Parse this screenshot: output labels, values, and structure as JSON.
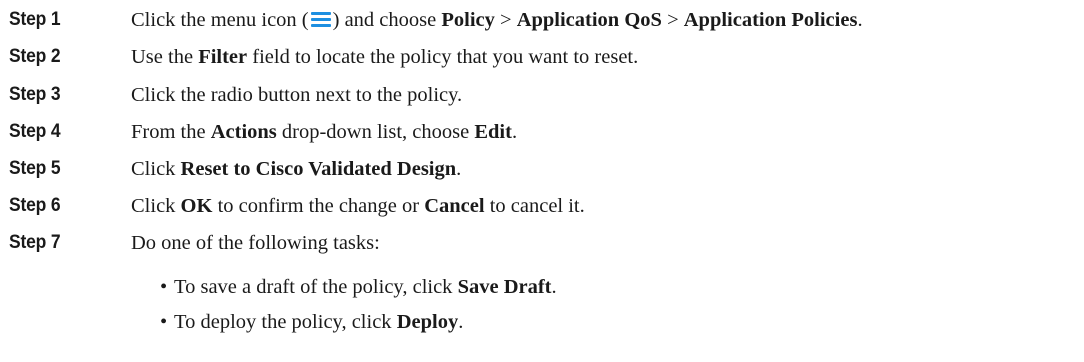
{
  "steps": [
    {
      "label": "Step 1",
      "parts": {
        "t1": "Click the menu icon (",
        "t2": ") and choose ",
        "b1": "Policy",
        "t3": " > ",
        "b2": "Application QoS",
        "t4": " > ",
        "b3": "Application Policies",
        "t5": "."
      }
    },
    {
      "label": "Step 2",
      "parts": {
        "t1": "Use the ",
        "b1": "Filter",
        "t2": " field to locate the policy that you want to reset."
      }
    },
    {
      "label": "Step 3",
      "parts": {
        "t1": "Click the radio button next to the policy."
      }
    },
    {
      "label": "Step 4",
      "parts": {
        "t1": "From the ",
        "b1": "Actions",
        "t2": " drop-down list, choose ",
        "b2": "Edit",
        "t3": "."
      }
    },
    {
      "label": "Step 5",
      "parts": {
        "t1": "Click ",
        "b1": "Reset to Cisco Validated Design",
        "t2": "."
      }
    },
    {
      "label": "Step 6",
      "parts": {
        "t1": "Click ",
        "b1": "OK",
        "t2": " to confirm the change or ",
        "b2": "Cancel",
        "t3": " to cancel it."
      }
    },
    {
      "label": "Step 7",
      "parts": {
        "t1": "Do one of the following tasks:"
      }
    }
  ],
  "sub_items": [
    {
      "bullet": "•",
      "t1": "To save a draft of the policy, click ",
      "b1": "Save Draft",
      "t2": "."
    },
    {
      "bullet": "•",
      "t1": "To deploy the policy, click ",
      "b1": "Deploy",
      "t2": "."
    }
  ],
  "icons": {
    "menu_icon": "menu-icon",
    "menu_icon_color": "#1d8fe1"
  }
}
